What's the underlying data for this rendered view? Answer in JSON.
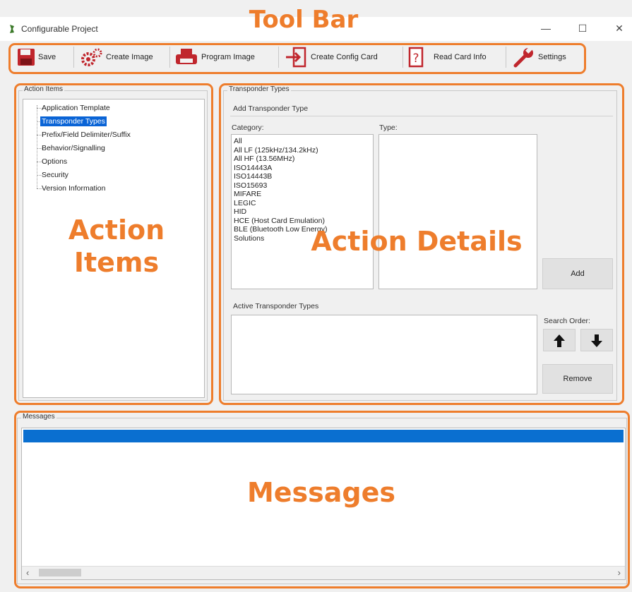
{
  "window": {
    "title": "Configurable Project",
    "minimize": "—",
    "maximize": "☐",
    "close": "✕"
  },
  "toolbar": {
    "buttons": [
      {
        "label": "Save",
        "icon": "floppy-disk-icon"
      },
      {
        "label": "Create Image",
        "icon": "gears-icon"
      },
      {
        "label": "Program Image",
        "icon": "printer-icon"
      },
      {
        "label": "Create Config Card",
        "icon": "card-arrow-icon"
      },
      {
        "label": "Read Card Info",
        "icon": "question-card-icon"
      },
      {
        "label": "Settings",
        "icon": "wrench-icon"
      }
    ]
  },
  "annotations": {
    "toolbar": "Tool Bar",
    "action_items": "Action Items",
    "action_details": "Action Details",
    "messages": "Messages",
    "color": "#ee7d2c"
  },
  "action_items": {
    "group_label": "Action Items",
    "items": [
      {
        "label": "Application Template",
        "selected": false
      },
      {
        "label": "Transponder Types",
        "selected": true
      },
      {
        "label": "Prefix/Field Delimiter/Suffix",
        "selected": false
      },
      {
        "label": "Behavior/Signalling",
        "selected": false
      },
      {
        "label": "Options",
        "selected": false
      },
      {
        "label": "Security",
        "selected": false
      },
      {
        "label": "Version Information",
        "selected": false
      }
    ],
    "selection_color": "#0a64d6"
  },
  "details": {
    "group_label": "Transponder Types",
    "add_section_label": "Add Transponder Type",
    "category_label": "Category:",
    "type_label": "Type:",
    "categories": [
      "All",
      "All LF (125kHz/134.2kHz)",
      "All HF (13.56MHz)",
      "ISO14443A",
      "ISO14443B",
      "ISO15693",
      "MIFARE",
      "LEGIC",
      "HID",
      "HCE (Host Card Emulation)",
      "BLE (Bluetooth Low Energy)",
      "Solutions"
    ],
    "add_button": "Add",
    "active_label": "Active Transponder Types",
    "search_order_label": "Search Order:",
    "up_icon": "arrow-up-icon",
    "down_icon": "arrow-down-icon",
    "remove_button": "Remove"
  },
  "messages": {
    "group_label": "Messages",
    "bar_color": "#0a6fd0",
    "scroll_left": "‹",
    "scroll_right": "›"
  }
}
